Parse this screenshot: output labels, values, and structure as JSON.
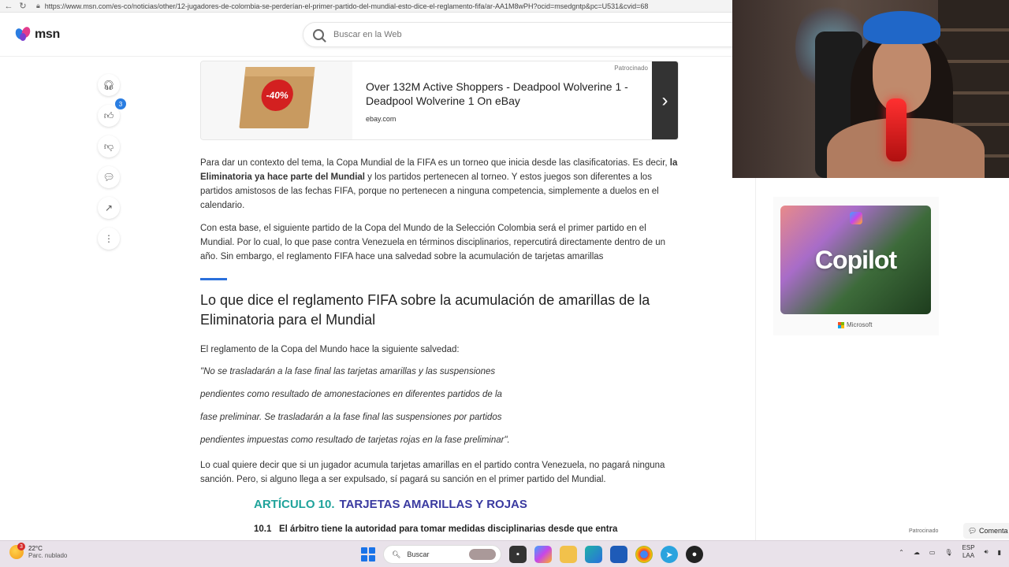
{
  "browser": {
    "url": "https://www.msn.com/es-co/noticias/other/12-jugadores-de-colombia-se-perderían-el-primer-partido-del-mundial-esto-dice-el-reglamento-fifa/ar-AA1M8wPH?ocid=msedgntp&pc=U531&cvid=68"
  },
  "header": {
    "logo_text": "msn",
    "search_placeholder": "Buscar en la Web"
  },
  "rail": {
    "likes_count": "3"
  },
  "ad": {
    "sponsored_label": "Patrocinado",
    "discount_label": "-40%",
    "title": "Over 132M Active Shoppers - Deadpool Wolverine 1 - Deadpool Wolverine 1 On eBay",
    "source": "ebay.com",
    "next_icon": "›"
  },
  "article": {
    "p1_a": "Para dar un contexto del tema, la Copa Mundial de la FIFA es un torneo que inicia desde las clasificatorias. Es decir, ",
    "p1_bold": "la Eliminatoria ya hace parte del Mundial",
    "p1_b": " y los partidos pertenecen al torneo. Y estos juegos son diferentes a los partidos amistosos de las fechas FIFA, porque no pertenecen a ninguna competencia, simplemente a duelos en el calendario.",
    "p2": "Con esta base, el siguiente partido de la Copa del Mundo de la Selección Colombia será el primer partido en el Mundial. Por lo cual, lo que pase contra Venezuela en términos disciplinarios, repercutirá directamente dentro de un año. Sin embargo, el reglamento FIFA hace una salvedad sobre la acumulación de tarjetas amarillas",
    "heading": "Lo que dice el reglamento FIFA sobre la acumulación de amarillas de la Eliminatoria para el Mundial",
    "p3": "El reglamento de la Copa del Mundo hace la siguiente salvedad:",
    "quote_lines": [
      "\"No se trasladarán a la fase final las tarjetas amarillas y las suspensiones",
      "pendientes como resultado de amonestaciones en diferentes partidos de la",
      "fase preliminar. Se trasladarán a la fase final las suspensiones por partidos",
      "pendientes impuestas como resultado de tarjetas rojas en la fase preliminar\"."
    ],
    "p4": "Lo cual quiere decir que si un jugador acumula tarjetas amarillas en el partido contra Venezuela, no pagará ninguna sanción. Pero, si alguno llega a ser expulsado, sí pagará su sanción en el primer partido del Mundial.",
    "article10_num": "ARTÍCULO 10.",
    "article10_title": "TARJETAS AMARILLAS Y ROJAS",
    "article10_line_num": "10.1",
    "article10_line": "El árbitro tiene la autoridad para tomar medidas disciplinarias desde que entra"
  },
  "right": {
    "copilot_word": "Copilot",
    "brand": "Microsoft",
    "sponsored_small": "Patrocinado",
    "comment_label": "Comenta"
  },
  "taskbar": {
    "temp": "22°C",
    "weather_desc": "Parc. nublado",
    "weather_alert": "3",
    "search_label": "Buscar",
    "lang_top": "ESP",
    "lang_bottom": "LAA"
  }
}
